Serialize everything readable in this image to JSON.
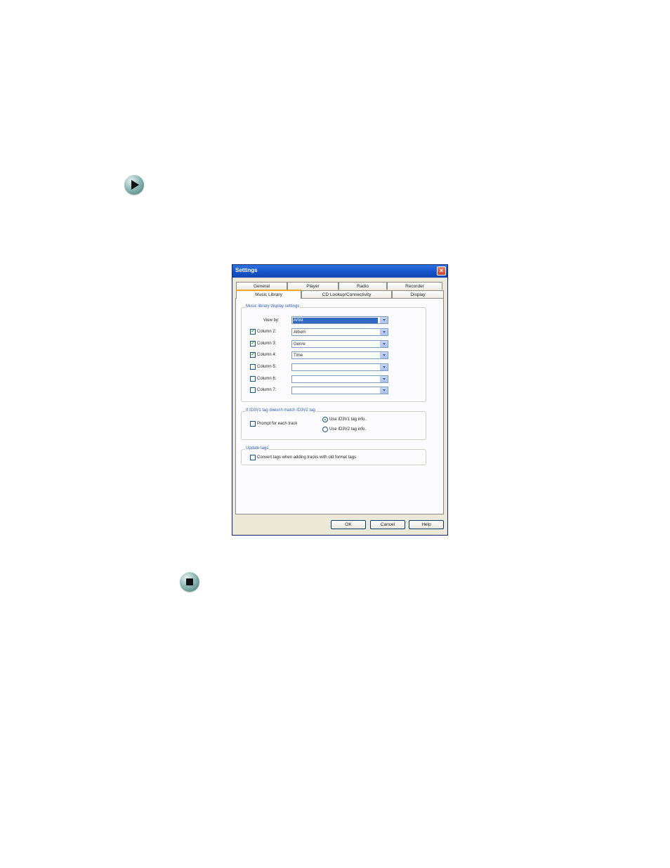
{
  "dialog": {
    "title": "Settings",
    "tabs_row1": [
      "General",
      "Player",
      "Radio",
      "Recorder"
    ],
    "tabs_row2": [
      "Music Library",
      "CD Lookup/Connectivity",
      "Display"
    ],
    "display_group": {
      "label": "Music library display settings",
      "view_by_label": "View by:",
      "view_by_value": "Artist",
      "columns": [
        {
          "label": "Column 2:",
          "checked": true,
          "value": "Album"
        },
        {
          "label": "Column 3:",
          "checked": true,
          "value": "Genre"
        },
        {
          "label": "Column 4:",
          "checked": true,
          "value": "Time"
        },
        {
          "label": "Column 5:",
          "checked": false,
          "value": ""
        },
        {
          "label": "Column 6:",
          "checked": false,
          "value": ""
        },
        {
          "label": "Column 7:",
          "checked": false,
          "value": ""
        }
      ]
    },
    "id3_group": {
      "label": "If ID3V1 tag doesn't match ID3V2 tag",
      "prompt_label": "Prompt for each track",
      "radio1_label": "Use ID3V1 tag info.",
      "radio2_label": "Use ID3V2 tag info."
    },
    "update_group": {
      "label": "Update tags",
      "convert_label": "Convert tags when adding tracks with old format tags"
    },
    "buttons": {
      "ok": "OK",
      "cancel": "Cancel",
      "help": "Help"
    }
  }
}
